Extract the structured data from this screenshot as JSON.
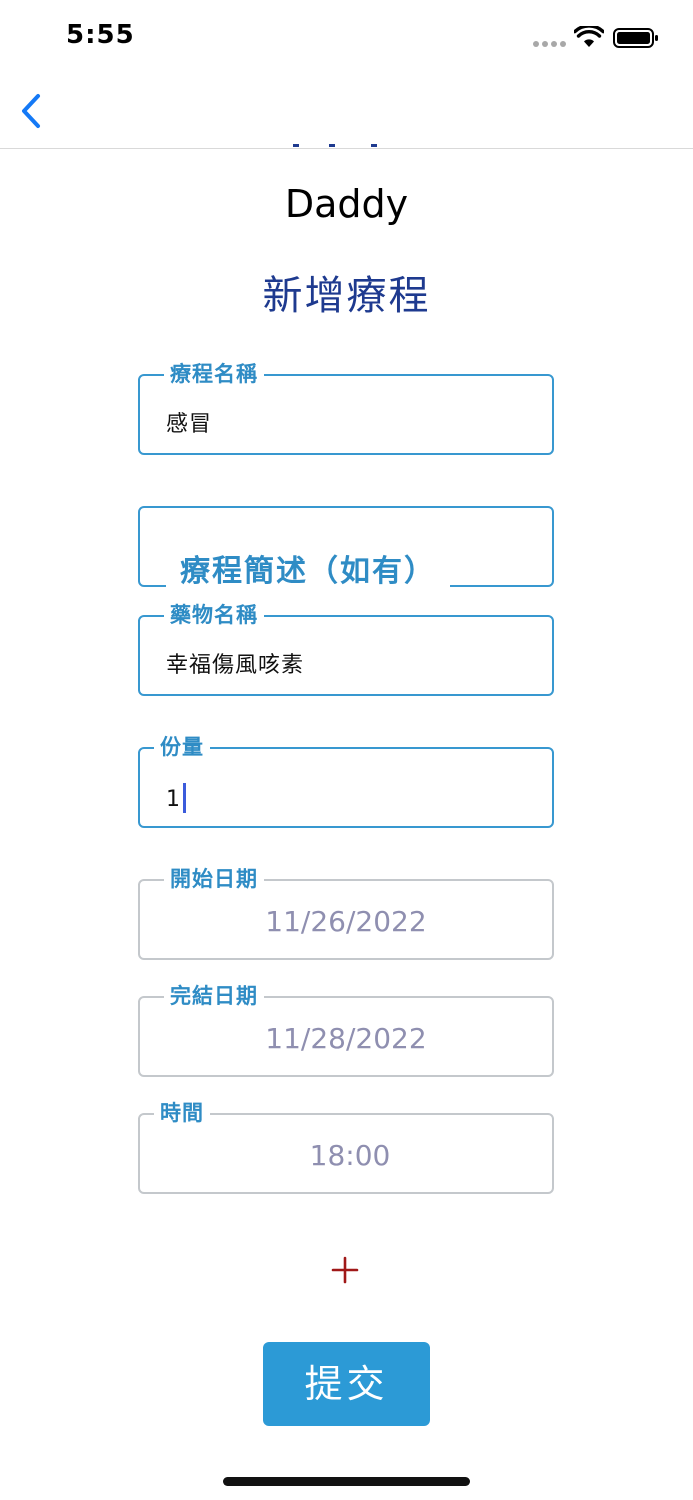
{
  "status_bar": {
    "time": "5:55"
  },
  "header": {
    "user_name": "Daddy",
    "title": "新增療程"
  },
  "form": {
    "course_name": {
      "label": "療程名稱",
      "value": "感冒"
    },
    "course_description": {
      "placeholder": "療程簡述（如有）"
    },
    "medicine_name": {
      "label": "藥物名稱",
      "value": "幸福傷風咳素"
    },
    "dosage": {
      "label": "份量",
      "value": "1"
    },
    "start_date": {
      "label": "開始日期",
      "value": "11/26/2022"
    },
    "end_date": {
      "label": "完結日期",
      "value": "11/28/2022"
    },
    "time": {
      "label": "時間",
      "value": "18:00"
    }
  },
  "actions": {
    "add_symbol": "+",
    "submit_label": "提交"
  },
  "colors": {
    "accent": "#2f8cc5",
    "title": "#1e3a8f",
    "add": "#a01818",
    "submit": "#2c9ad6"
  }
}
